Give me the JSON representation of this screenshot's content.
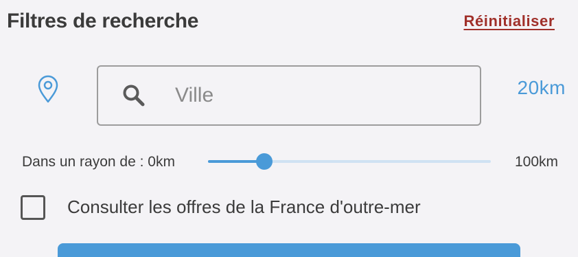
{
  "header": {
    "title": "Filtres de recherche",
    "reset_label": "Réinitialiser"
  },
  "location": {
    "icon": "map-pin-icon",
    "search_icon": "search-icon",
    "placeholder": "Ville",
    "value": "",
    "radius_display": "20km"
  },
  "radius": {
    "label": "Dans un rayon de : 0km",
    "min": 0,
    "max": 100,
    "max_label": "100km",
    "value": 20
  },
  "overseas": {
    "label": "Consulter les offres de la France d'outre-mer",
    "checked": false
  },
  "colors": {
    "accent": "#4a9ad8",
    "reset": "#a0302a",
    "text": "#3b3b3b",
    "background": "#f4f3f6"
  }
}
